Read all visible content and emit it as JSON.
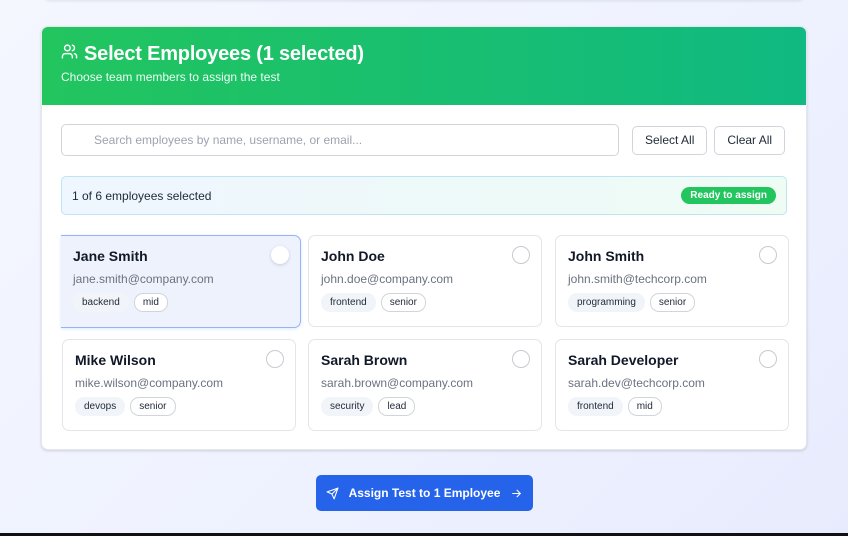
{
  "header": {
    "title": "Select Employees (1 selected)",
    "subtitle": "Choose team members to assign the test",
    "icon": "users-icon"
  },
  "toolbar": {
    "search_placeholder": "Search employees by name, username, or email...",
    "search_value": "",
    "select_all_label": "Select All",
    "clear_all_label": "Clear All"
  },
  "status": {
    "text": "1 of 6 employees selected",
    "badge": "Ready to assign"
  },
  "employees": [
    {
      "name": "Jane Smith",
      "email": "jane.smith@company.com",
      "tags": [
        "backend",
        "mid"
      ],
      "selected": true
    },
    {
      "name": "John Doe",
      "email": "john.doe@company.com",
      "tags": [
        "frontend",
        "senior"
      ],
      "selected": false
    },
    {
      "name": "John Smith",
      "email": "john.smith@techcorp.com",
      "tags": [
        "programming",
        "senior"
      ],
      "selected": false
    },
    {
      "name": "Mike Wilson",
      "email": "mike.wilson@company.com",
      "tags": [
        "devops",
        "senior"
      ],
      "selected": false
    },
    {
      "name": "Sarah Brown",
      "email": "sarah.brown@company.com",
      "tags": [
        "security",
        "lead"
      ],
      "selected": false
    },
    {
      "name": "Sarah Developer",
      "email": "sarah.dev@techcorp.com",
      "tags": [
        "frontend",
        "mid"
      ],
      "selected": false
    }
  ],
  "assign_button": {
    "label": "Assign Test to 1 Employee",
    "icon": "send-icon",
    "trailing_icon": "arrow-right-icon"
  },
  "colors": {
    "header_gradient_start": "#22c55e",
    "header_gradient_end": "#10b981",
    "primary": "#2563eb",
    "badge": "#22c55e"
  }
}
